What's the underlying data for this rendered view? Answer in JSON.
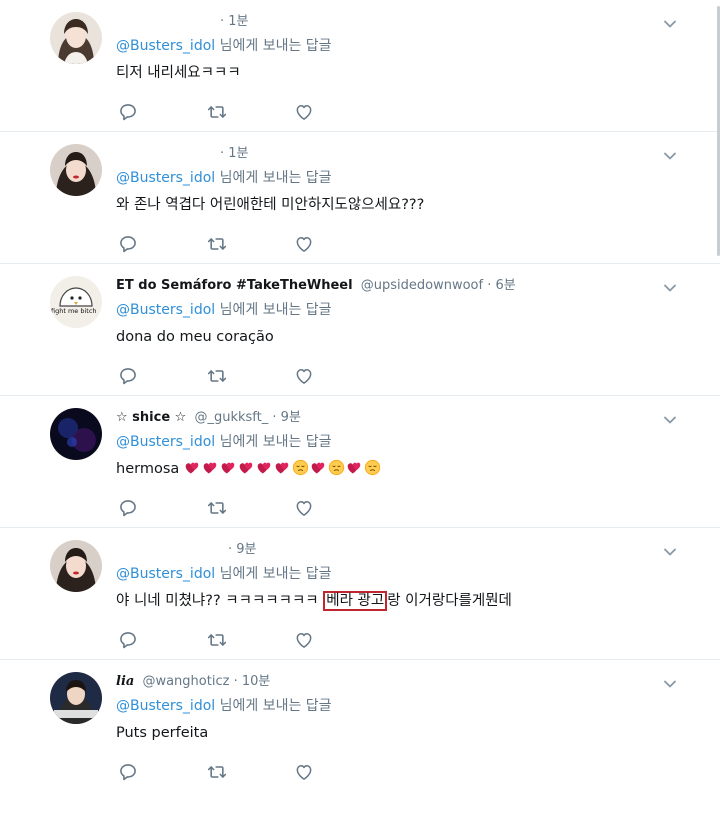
{
  "reply_prefix_suffix": "님에게 보내는 답글",
  "colors": {
    "mention": "#2f8fd8",
    "divider": "#e6ecf0",
    "highlight_box": "#c0262e"
  },
  "icons": {
    "reply": "reply-icon",
    "retweet": "retweet-icon",
    "like": "heart-icon",
    "menu": "chevron-down-icon"
  },
  "tweets": [
    {
      "name": "",
      "handle": "",
      "time": "· 1분",
      "reply_to": "@Busters_idol",
      "text": "티저 내리세요ㅋㅋㅋ"
    },
    {
      "name": "",
      "handle": "",
      "time": "· 1분",
      "reply_to": "@Busters_idol",
      "text": "와 존나 역겹다 어린애한테 미안하지도않으세요???"
    },
    {
      "name": "ET do Semáforo #TakeTheWheel",
      "handle": "@upsidedownwoof",
      "time": "· 6분",
      "reply_to": "@Busters_idol",
      "text": "dona do meu coração",
      "avatar_caption": "fight me bitch"
    },
    {
      "name": "☆ shice ☆",
      "handle": "@_gukksft_",
      "time": "· 9분",
      "reply_to": "@Busters_idol",
      "text": "hermosa"
    },
    {
      "name": "",
      "handle": "",
      "time": "· 9분",
      "reply_to": "@Busters_idol",
      "text_before": "야 니네 미쳤냐?? ㅋㅋㅋㅋㅋㅋㅋ ",
      "text_highlight": "베라 광고",
      "text_after": "랑 이거랑다를게뭔데"
    },
    {
      "name": "lia",
      "handle": "@wanghoticz",
      "time": "· 10분",
      "reply_to": "@Busters_idol",
      "text": "Puts perfeita"
    }
  ]
}
